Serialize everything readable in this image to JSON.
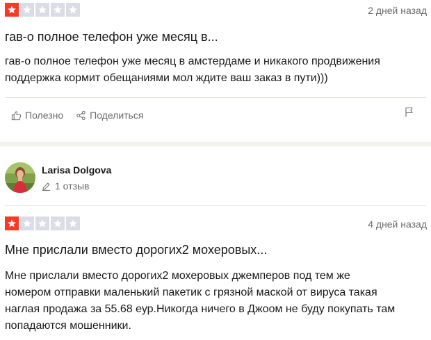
{
  "review1": {
    "rating": 1,
    "max_rating": 5,
    "date": "2 дней назад",
    "title": "гав-о полное телефон уже месяц в...",
    "body_lines": [
      "гав-о полное телефон уже месяц в амстердаме и никакого продвижения",
      "поддержка кормит обещаниями мол ждите ваш заказ в пути)))"
    ],
    "useful_label": "Полезно",
    "share_label": "Поделиться"
  },
  "reviewer2": {
    "name": "Larisa Dolgova",
    "review_count": "1 отзыв"
  },
  "review2": {
    "rating": 1,
    "max_rating": 5,
    "date": "4 дней назад",
    "title": "Мне прислали вместо дорогих2 мохеровых...",
    "body_lines": [
      "Мне прислали вместо дорогих2 мохеровых джемперов под тем же",
      "номером отправки маленький пакетик с грязной маской от вируса такая",
      "наглая продажа за 55.68 еур.Никогда ничего в Джоом не буду покупать там",
      "попадаются мошенники."
    ]
  },
  "colors": {
    "star_active": "#ff3722",
    "star_inactive": "#dcdce6",
    "muted_text": "#6b6b6b",
    "divider": "#e5e5dd"
  },
  "icons": [
    "star-icon",
    "thumbs-up-icon",
    "share-icon",
    "flag-icon",
    "pencil-icon",
    "avatar"
  ]
}
